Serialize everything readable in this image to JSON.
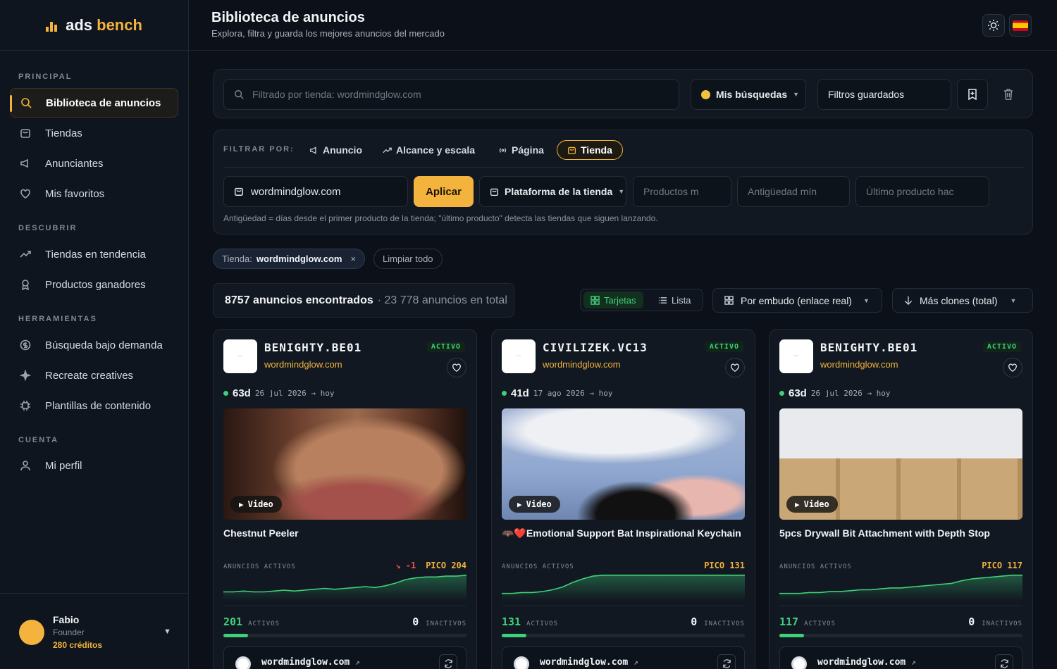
{
  "brand": {
    "word1": "ads",
    "word2": "bench"
  },
  "sidebar": {
    "sections": [
      "PRINCIPAL",
      "DESCUBRIR",
      "HERRAMIENTAS",
      "CUENTA"
    ],
    "items": [
      {
        "label": "Biblioteca de anuncios",
        "icon": "search-icon"
      },
      {
        "label": "Tiendas",
        "icon": "store-icon"
      },
      {
        "label": "Anunciantes",
        "icon": "megaphone-icon"
      },
      {
        "label": "Mis favoritos",
        "icon": "heart-icon"
      },
      {
        "label": "Tiendas en tendencia",
        "icon": "trending-icon"
      },
      {
        "label": "Productos ganadores",
        "icon": "award-icon"
      },
      {
        "label": "Búsqueda bajo demanda",
        "icon": "dollar-icon"
      },
      {
        "label": "Recreate creatives",
        "icon": "sparkle-icon"
      },
      {
        "label": "Plantillas de contenido",
        "icon": "cpu-icon"
      },
      {
        "label": "Mi perfil",
        "icon": "user-icon"
      }
    ],
    "user": {
      "name": "Fabio",
      "role": "Founder",
      "credits": "280 créditos"
    }
  },
  "header": {
    "title": "Biblioteca de anuncios",
    "subtitle": "Explora, filtra y guarda los mejores anuncios del mercado"
  },
  "search": {
    "placeholder": "Filtrado por tienda: wordmindglow.com",
    "my_searches": "Mis búsquedas",
    "saved_filters": "Filtros guardados"
  },
  "filters": {
    "label": "FILTRAR POR:",
    "tabs": [
      "Anuncio",
      "Alcance y escala",
      "Página",
      "Tienda"
    ],
    "store_value": "wordmindglow.com",
    "apply": "Aplicar",
    "platform": "Plataforma de la tienda",
    "products_placeholder": "Productos m",
    "age_placeholder": "Antigüedad mín",
    "last_product_placeholder": "Último producto hac",
    "hint": "Antigüedad = días desde el primer producto de la tienda; \"último producto\" detecta las tiendas que siguen lanzando."
  },
  "chips": {
    "store_label": "Tienda:",
    "store_value": "wordmindglow.com",
    "clear": "Limpiar todo"
  },
  "results": {
    "found": "8757 anuncios encontrados",
    "total": "· 23 778 anuncios en total",
    "view_cards": "Tarjetas",
    "view_list": "Lista",
    "group_by": "Por embudo (enlace real)",
    "sort_by": "Más clones (total)"
  },
  "cards": [
    {
      "name": "BENIGHTY.BE01",
      "domain": "wordmindglow.com",
      "status": "ACTIVO",
      "days": "63d",
      "dates": "26 jul 2026 → hoy",
      "media_label": "Video",
      "product": "Chestnut Peeler",
      "active_label": "ANUNCIOS ACTIVOS",
      "delta": "-1",
      "peak": "PICO 204",
      "active_count": "201",
      "active_word": "ACTIVOS",
      "inactive_count": "0",
      "inactive_word": "INACTIVOS",
      "progress": 0.1,
      "footer_domain": "wordmindglow.com",
      "spark": [
        10,
        10,
        11,
        10,
        10,
        11,
        12,
        11,
        12,
        13,
        14,
        13,
        14,
        15,
        16,
        15,
        17,
        20,
        24,
        26,
        27,
        27,
        28,
        28,
        29
      ]
    },
    {
      "name": "CIVILIZEK.VC13",
      "domain": "wordmindglow.com",
      "status": "ACTIVO",
      "days": "41d",
      "dates": "17 ago 2026 → hoy",
      "media_label": "Video",
      "product": "🦇❤️Emotional Support Bat Inspirational Keychain",
      "active_label": "ANUNCIOS ACTIVOS",
      "delta": "",
      "peak": "PICO 131",
      "active_count": "131",
      "active_word": "ACTIVOS",
      "inactive_count": "0",
      "inactive_word": "INACTIVOS",
      "progress": 0.1,
      "footer_domain": "wordmindglow.com",
      "spark": [
        8,
        8,
        9,
        9,
        10,
        12,
        15,
        20,
        24,
        27,
        28,
        28,
        28,
        28,
        28,
        28,
        28,
        28,
        28,
        28,
        28,
        28,
        28,
        28,
        28
      ]
    },
    {
      "name": "BENIGHTY.BE01",
      "domain": "wordmindglow.com",
      "status": "ACTIVO",
      "days": "63d",
      "dates": "26 jul 2026 → hoy",
      "media_label": "Video",
      "product": "5pcs Drywall Bit Attachment with Depth Stop",
      "active_label": "ANUNCIOS ACTIVOS",
      "delta": "",
      "peak": "PICO 117",
      "active_count": "117",
      "active_word": "ACTIVOS",
      "inactive_count": "0",
      "inactive_word": "INACTIVOS",
      "progress": 0.1,
      "footer_domain": "wordmindglow.com",
      "spark": [
        8,
        8,
        8,
        9,
        9,
        10,
        10,
        11,
        12,
        12,
        13,
        14,
        14,
        15,
        16,
        17,
        18,
        19,
        22,
        24,
        25,
        26,
        27,
        28,
        28
      ]
    }
  ],
  "colors": {
    "accent": "#f3b33d",
    "positive": "#3fd07a",
    "negative": "#ef5350"
  }
}
